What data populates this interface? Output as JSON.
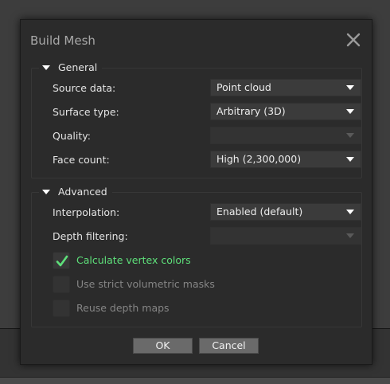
{
  "dialog": {
    "title": "Build Mesh"
  },
  "general": {
    "header": "General",
    "fields": [
      {
        "label": "Source data:",
        "value": "Point cloud",
        "enabled": true
      },
      {
        "label": "Surface type:",
        "value": "Arbitrary (3D)",
        "enabled": true
      },
      {
        "label": "Quality:",
        "value": "",
        "enabled": false
      },
      {
        "label": "Face count:",
        "value": "High (2,300,000)",
        "enabled": true
      }
    ]
  },
  "advanced": {
    "header": "Advanced",
    "fields": [
      {
        "label": "Interpolation:",
        "value": "Enabled (default)",
        "enabled": true
      },
      {
        "label": "Depth filtering:",
        "value": "",
        "enabled": false
      }
    ],
    "checkboxes": [
      {
        "label": "Calculate vertex colors",
        "checked": true,
        "enabled": true
      },
      {
        "label": "Use strict volumetric masks",
        "checked": false,
        "enabled": false
      },
      {
        "label": "Reuse depth maps",
        "checked": false,
        "enabled": false
      }
    ]
  },
  "buttons": {
    "ok": "OK",
    "cancel": "Cancel"
  },
  "colors": {
    "dialog_bg": "#2b2b2b",
    "combo_bg": "#3b3b3b",
    "check_accent": "#5ee07a",
    "button_bg": "#6a6a6a"
  },
  "icons": {
    "close": "close-x-icon",
    "collapse": "triangle-down-icon",
    "dropdown": "triangle-down-icon",
    "check": "checkmark-icon"
  }
}
